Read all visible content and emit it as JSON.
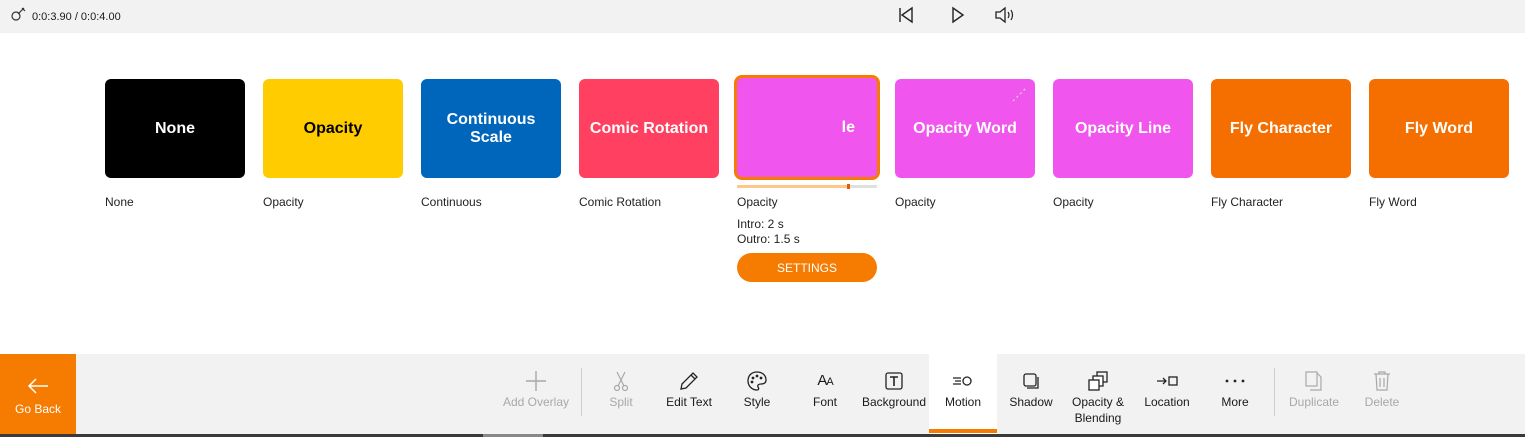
{
  "topbar": {
    "time": "0:0:3.90 / 0:0:4.00"
  },
  "cards": [
    {
      "id": "none",
      "preview_text": "None",
      "label": "None",
      "bg": "#000000",
      "fg": "#ffffff"
    },
    {
      "id": "opacity",
      "preview_text": "Opacity",
      "label": "Opacity",
      "bg": "#ffcc00",
      "fg": "#000000"
    },
    {
      "id": "continuous",
      "preview_text": "Continuous Scale",
      "label": "Continuous",
      "bg": "#0066bb",
      "fg": "#ffffff"
    },
    {
      "id": "comic",
      "preview_text": "Comic Rotation",
      "label": "Comic Rotation",
      "bg": "#ff4060",
      "fg": "#ffffff"
    },
    {
      "id": "selected",
      "preview_text": "le",
      "label": "Opacity",
      "bg": "#f055ee",
      "fg": "#ffffff",
      "intro": "Intro: 2 s",
      "outro": "Outro: 1.5 s",
      "settings": "SETTINGS",
      "progress": 0.81
    },
    {
      "id": "opacity-word",
      "preview_text": "Opacity Word",
      "label": "Opacity",
      "bg": "#f055ee",
      "fg": "#ffffff"
    },
    {
      "id": "opacity-line",
      "preview_text": "Opacity Line",
      "label": "Opacity",
      "bg": "#f055ee",
      "fg": "#ffffff"
    },
    {
      "id": "fly-character",
      "preview_text": "Fly Character",
      "label": "Fly Character",
      "bg": "#f56f00",
      "fg": "#ffffff"
    },
    {
      "id": "fly-word",
      "preview_text": "Fly Word",
      "label": "Fly Word",
      "bg": "#f56f00",
      "fg": "#ffffff"
    }
  ],
  "toolbar": {
    "go_back": "Go Back",
    "add_overlay": "Add Overlay",
    "split": "Split",
    "edit_text": "Edit Text",
    "style": "Style",
    "font": "Font",
    "background": "Background",
    "motion": "Motion",
    "shadow": "Shadow",
    "opacity_line1": "Opacity &",
    "opacity_line2": "Blending",
    "location": "Location",
    "more": "More",
    "duplicate": "Duplicate",
    "delete": "Delete"
  },
  "colors": {
    "accent": "#f57c00",
    "disabled": "#a8a8a8"
  }
}
